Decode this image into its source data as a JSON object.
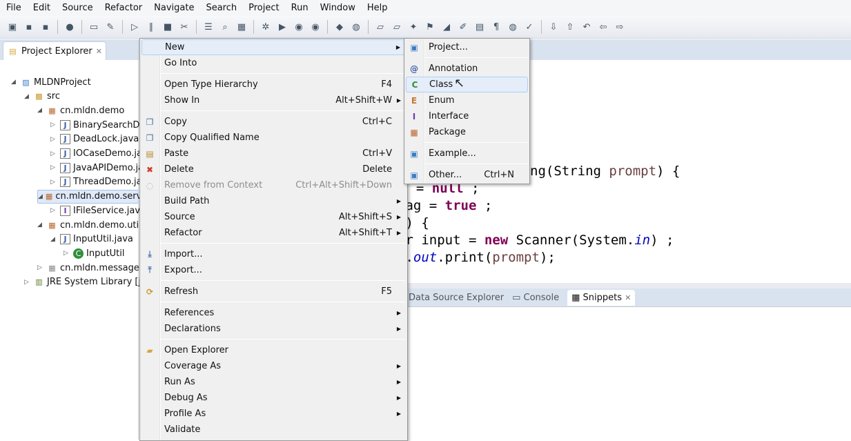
{
  "menubar": [
    "File",
    "Edit",
    "Source",
    "Refactor",
    "Navigate",
    "Search",
    "Project",
    "Run",
    "Window",
    "Help"
  ],
  "explorer": {
    "tab": "Project Explorer",
    "tree": [
      {
        "label": "MLDNProject",
        "level": 0,
        "twisty": "open",
        "icon": "project-icon"
      },
      {
        "label": "src",
        "level": 1,
        "twisty": "open",
        "icon": "source-folder-icon"
      },
      {
        "label": "cn.mldn.demo",
        "level": 2,
        "twisty": "open",
        "icon": "package-icon"
      },
      {
        "label": "BinarySearchDe",
        "level": 3,
        "twisty": "closed",
        "icon": "java-file-icon"
      },
      {
        "label": "DeadLock.java",
        "level": 3,
        "twisty": "closed",
        "icon": "java-file-icon"
      },
      {
        "label": "IOCaseDemo.ja",
        "level": 3,
        "twisty": "closed",
        "icon": "java-file-icon"
      },
      {
        "label": "JavaAPIDemo.ja",
        "level": 3,
        "twisty": "closed",
        "icon": "java-file-icon"
      },
      {
        "label": "ThreadDemo.ja",
        "level": 3,
        "twisty": "closed",
        "icon": "java-file-icon"
      },
      {
        "label": "cn.mldn.demo.serv",
        "level": 2,
        "twisty": "open",
        "icon": "package-icon",
        "selected": true
      },
      {
        "label": "IFileService.java",
        "level": 3,
        "twisty": "closed",
        "icon": "interface-file-icon"
      },
      {
        "label": "cn.mldn.demo.util",
        "level": 2,
        "twisty": "open",
        "icon": "package-icon"
      },
      {
        "label": "InputUtil.java",
        "level": 3,
        "twisty": "open",
        "icon": "java-file-icon"
      },
      {
        "label": "InputUtil",
        "level": 4,
        "twisty": "closed",
        "icon": "class-icon"
      },
      {
        "label": "cn.mldn.message",
        "level": 2,
        "twisty": "closed",
        "icon": "empty-package-icon"
      },
      {
        "label": "JRE System Library [jd",
        "level": 1,
        "twisty": "closed",
        "icon": "library-icon"
      }
    ]
  },
  "editor": {
    "lines": [
      [
        {
          "t": "ng(String ",
          "c": ""
        },
        {
          "t": "prompt",
          "c": "param"
        },
        {
          "t": ") {",
          "c": ""
        }
      ],
      [
        {
          "t": "r = ",
          "c": ""
        },
        {
          "t": "null",
          "c": "kw"
        },
        {
          "t": " ;",
          "c": ""
        }
      ],
      [
        {
          "t": "lag = ",
          "c": ""
        },
        {
          "t": "true",
          "c": "kw"
        },
        {
          "t": " ;",
          "c": ""
        }
      ],
      [
        {
          "t": "g) {",
          "c": ""
        }
      ],
      [
        {
          "t": "er input = ",
          "c": ""
        },
        {
          "t": "new",
          "c": "kw"
        },
        {
          "t": " Scanner(System.",
          "c": ""
        },
        {
          "t": "in",
          "c": "fld"
        },
        {
          "t": ") ;",
          "c": ""
        }
      ],
      [
        {
          "t": "n.",
          "c": ""
        },
        {
          "t": "out",
          "c": "fld"
        },
        {
          "t": ".print(",
          "c": ""
        },
        {
          "t": "prompt",
          "c": "param"
        },
        {
          "t": ");",
          "c": ""
        }
      ]
    ]
  },
  "bottom_tabs": [
    "Data Source Explorer",
    "Console",
    "Snippets"
  ],
  "context_menu": [
    {
      "label": "New",
      "arrow": true,
      "icon": "",
      "hl": true
    },
    {
      "label": "Go Into"
    },
    {
      "sep": true
    },
    {
      "label": "Open Type Hierarchy",
      "shortcut": "F4"
    },
    {
      "label": "Show In",
      "shortcut": "Alt+Shift+W",
      "arrow": true
    },
    {
      "sep": true
    },
    {
      "label": "Copy",
      "shortcut": "Ctrl+C",
      "icon": "copy-icon"
    },
    {
      "label": "Copy Qualified Name",
      "icon": "copy-qualified-icon"
    },
    {
      "label": "Paste",
      "shortcut": "Ctrl+V",
      "icon": "paste-icon"
    },
    {
      "label": "Delete",
      "shortcut": "Delete",
      "icon": "delete-icon"
    },
    {
      "label": "Remove from Context",
      "shortcut": "Ctrl+Alt+Shift+Down",
      "disabled": true,
      "icon": "remove-context-icon"
    },
    {
      "label": "Build Path",
      "arrow": true
    },
    {
      "label": "Source",
      "shortcut": "Alt+Shift+S",
      "arrow": true
    },
    {
      "label": "Refactor",
      "shortcut": "Alt+Shift+T",
      "arrow": true
    },
    {
      "sep": true
    },
    {
      "label": "Import...",
      "icon": "import-icon"
    },
    {
      "label": "Export...",
      "icon": "export-icon"
    },
    {
      "sep": true
    },
    {
      "label": "Refresh",
      "shortcut": "F5",
      "icon": "refresh-icon"
    },
    {
      "sep": true
    },
    {
      "label": "References",
      "arrow": true
    },
    {
      "label": "Declarations",
      "arrow": true
    },
    {
      "sep": true
    },
    {
      "label": "Open Explorer",
      "icon": "folder-icon"
    },
    {
      "label": "Coverage As",
      "arrow": true
    },
    {
      "label": "Run As",
      "arrow": true
    },
    {
      "label": "Debug As",
      "arrow": true
    },
    {
      "label": "Profile As",
      "arrow": true
    },
    {
      "label": "Validate"
    }
  ],
  "new_submenu": [
    {
      "label": "Project...",
      "icon": "new-project-icon"
    },
    {
      "sep": true
    },
    {
      "label": "Annotation",
      "icon": "annotation-icon"
    },
    {
      "label": "Class",
      "icon": "class-icon",
      "hl": true
    },
    {
      "label": "Enum",
      "icon": "enum-icon"
    },
    {
      "label": "Interface",
      "icon": "interface-icon"
    },
    {
      "label": "Package",
      "icon": "package-icon"
    },
    {
      "sep": true
    },
    {
      "label": "Example...",
      "icon": "example-icon"
    },
    {
      "sep": true
    },
    {
      "label": "Other...",
      "shortcut": "Ctrl+N",
      "icon": "new-wizard-icon"
    }
  ]
}
